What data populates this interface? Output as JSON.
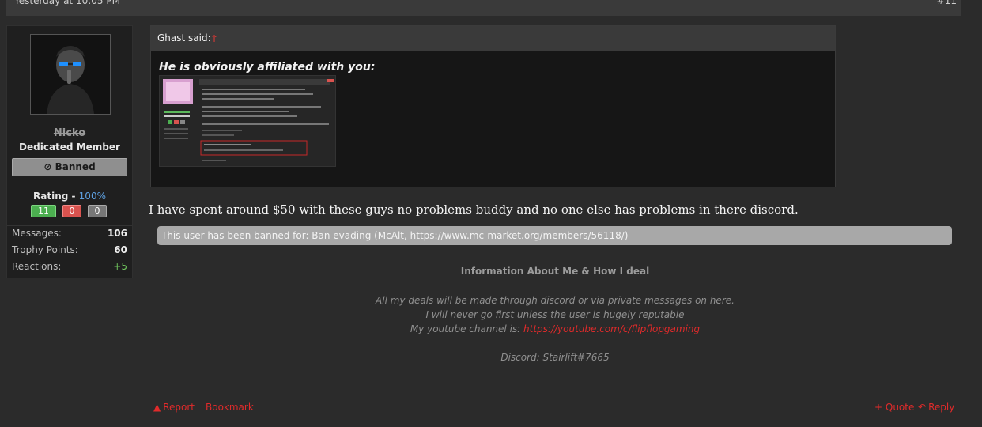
{
  "post": {
    "timestamp": "Yesterday at 10:05 PM",
    "number": "#11"
  },
  "user": {
    "name": "Nicko",
    "title": "Dedicated Member",
    "banned_label": "Banned",
    "rating_label": "Rating - ",
    "rating_percent": "100%",
    "positive": "11",
    "negative": "0",
    "neutral": "0",
    "stats": [
      {
        "label": "Messages:",
        "value": "106"
      },
      {
        "label": "Trophy Points:",
        "value": "60"
      },
      {
        "label": "Reactions:",
        "value": "+5"
      }
    ]
  },
  "quote": {
    "author_label": "Ghast said:",
    "arrow": "↑",
    "text": "He is obviously affiliated with you:"
  },
  "message": "I have spent around $50 with these guys no problems buddy and no one else has problems in there discord.",
  "ban_notice": "This user has been banned for: Ban evading (McAlt, https://www.mc-market.org/members/56118/)",
  "signature": {
    "title": "Information About Me & How I deal",
    "line1": "All my deals will be made through discord or via private messages on here.",
    "line2": "I will never go first unless the user is hugely reputable",
    "line3_prefix": "My youtube channel is: ",
    "youtube_link": "https://youtube.com/c/flipflopgaming",
    "discord": "Discord: Stairlift#7665"
  },
  "actions": {
    "report": "Report",
    "bookmark": "Bookmark",
    "quote": "+ Quote",
    "reply": "Reply"
  },
  "colors": {
    "accent_red": "#e02b2b",
    "rating_blue": "#5ea0e0",
    "positive_green": "#4caf50"
  }
}
